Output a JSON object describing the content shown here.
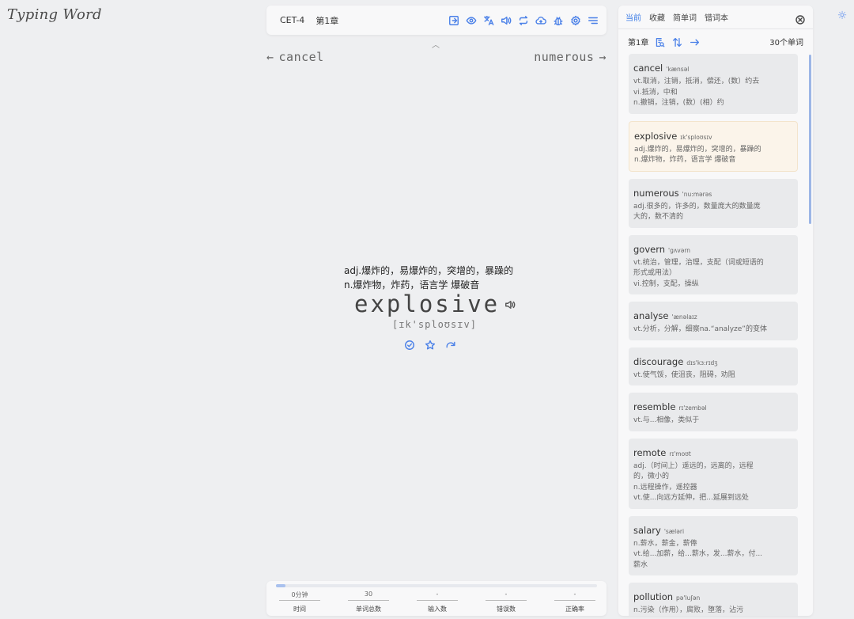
{
  "app": {
    "logo": "Typing Word"
  },
  "toolbar": {
    "dict": "CET-4",
    "chapter": "第1章",
    "icons": [
      "exit-icon",
      "eye-icon",
      "translate-icon",
      "volume-icon",
      "repeat-icon",
      "cloud-upload-icon",
      "bug-icon",
      "settings-icon",
      "menu-icon"
    ]
  },
  "nav": {
    "prev_word": "cancel",
    "next_word": "numerous",
    "prev_arrow": "←",
    "next_arrow": "→"
  },
  "current": {
    "meaning_1": "adj.爆炸的，易爆炸的，突增的，暴躁的",
    "meaning_2": "n.爆炸物，炸药，语言学 爆破音",
    "word": "explosive",
    "phonetic": "[ɪk'sploʊsɪv]"
  },
  "stats": {
    "progress": 0.03,
    "items": [
      {
        "value": "0分钟",
        "label": "时间"
      },
      {
        "value": "30",
        "label": "单词总数"
      },
      {
        "value": "-",
        "label": "输入数"
      },
      {
        "value": "-",
        "label": "错误数"
      },
      {
        "value": "-",
        "label": "正确率"
      }
    ]
  },
  "panel": {
    "tabs": [
      "当前",
      "收藏",
      "简单词",
      "错词本"
    ],
    "chapter": "第1章",
    "count": "30个单词",
    "words": [
      {
        "word": "cancel",
        "phonetic": "'kænsəl",
        "meaning": "vt.取消，注销，抵消，偿还，(数）约去\nvi.抵消，中和\nn.撤销，注销，(数）(相）约"
      },
      {
        "word": "explosive",
        "phonetic": "ɪk'sploʊsɪv",
        "meaning": "adj.爆炸的，易爆炸的，突增的，暴躁的\nn.爆炸物，炸药，语言学 爆破音"
      },
      {
        "word": "numerous",
        "phonetic": "'nu:mərəs",
        "meaning": "adj.很多的，许多的，数量庞大的数量庞\n大的，数不清的"
      },
      {
        "word": "govern",
        "phonetic": "'gʌvərn",
        "meaning": "vt.统治，管理，治理，支配（词或短语的\n形式或用法）\nvi.控制，支配，操纵"
      },
      {
        "word": "analyse",
        "phonetic": "'ænəlaɪz",
        "meaning": "vt.分析，分解，细察na.“analyze”的变体"
      },
      {
        "word": "discourage",
        "phonetic": "dɪs'kɜ:rɪdʒ",
        "meaning": "vt.使气馁，使沮丧，阻碍，劝阻"
      },
      {
        "word": "resemble",
        "phonetic": "rɪ'zembəl",
        "meaning": "vt.与...相像，类似于"
      },
      {
        "word": "remote",
        "phonetic": "rɪ'moʊt",
        "meaning": "adj.（时间上）遥远的，远离的，远程\n的，微小的\nn.远程操作，遥控器\nvt.使...向远方延伸，把...延展到远处"
      },
      {
        "word": "salary",
        "phonetic": "'sæləri",
        "meaning": "n.薪水，薪金，薪俸\nvt.给...加薪，给...薪水，发...薪水，付...\n薪水"
      },
      {
        "word": "pollution",
        "phonetic": "pə'luʃən",
        "meaning": "n.污染（作用），腐败，堕落，沾污"
      }
    ]
  }
}
